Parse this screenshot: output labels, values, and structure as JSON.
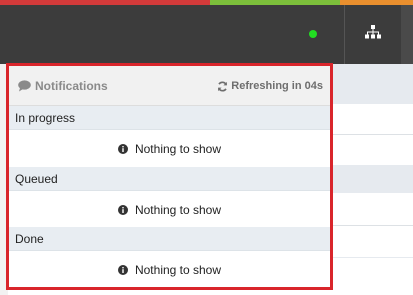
{
  "topbar": {
    "strip_colors": [
      "#d33a3a",
      "#3d8fd1",
      "#d33a3a",
      "#3c3c3c",
      "#d33a3a",
      "#7cbf3b",
      "#e98f2e"
    ],
    "status_color": "#22dd22",
    "sitemap_icon": "sitemap-icon"
  },
  "notifications": {
    "title": "Notifications",
    "title_icon": "comment-icon",
    "refresh_text": "Refreshing in 04s",
    "refresh_icon": "refresh-icon",
    "sections": [
      {
        "label": "In progress",
        "empty_text": "Nothing to show"
      },
      {
        "label": "Queued",
        "empty_text": "Nothing to show"
      },
      {
        "label": "Done",
        "empty_text": "Nothing to show"
      }
    ]
  }
}
